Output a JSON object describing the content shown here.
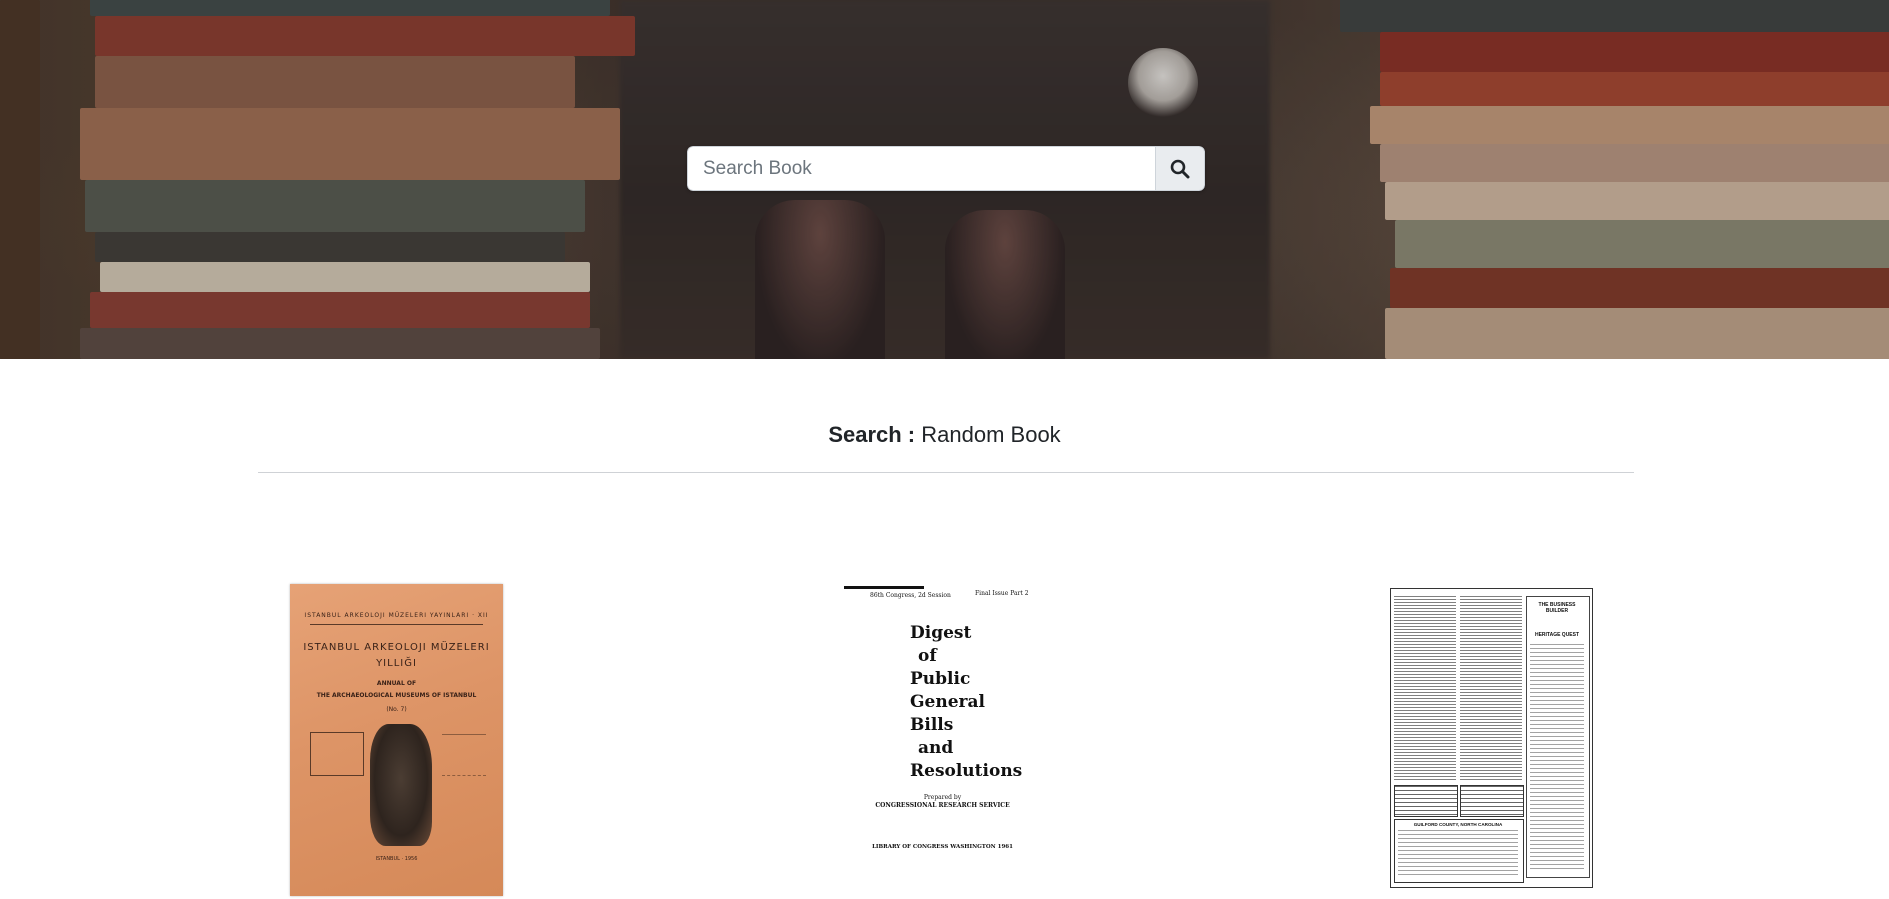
{
  "search": {
    "placeholder": "Search Book",
    "value": "",
    "button_icon": "search-icon"
  },
  "results": {
    "label": "Search :",
    "query": "Random Book"
  },
  "books": [
    {
      "cover_lines": [
        "ISTANBUL ARKEOLOJI MÜZELERI YAYINLARI · XII",
        "ISTANBUL ARKEOLOJI MÜZELERI",
        "YILLIĞI",
        "ANNUAL OF",
        "THE ARCHAEOLOGICAL MUSEUMS OF ISTANBUL",
        "(No. 7)",
        "ISTANBUL · 1956"
      ]
    },
    {
      "cover_lines": [
        "86th Congress, 2d Session",
        "Final Issue Part 2",
        "Digest",
        "of",
        "Public",
        "General",
        "Bills",
        "and",
        "Resolutions",
        "Prepared by",
        "CONGRESSIONAL RESEARCH SERVICE",
        "LIBRARY OF CONGRESS WASHINGTON 1961"
      ]
    },
    {
      "cover_lines": [
        "THE BUSINESS BUILDER",
        "HERITAGE QUEST",
        "GUILFORD COUNTY, NORTH CAROLINA"
      ]
    }
  ],
  "colors": {
    "accent_button_bg": "#e9ecef",
    "text": "#212529",
    "divider": "#cfd2d6"
  }
}
